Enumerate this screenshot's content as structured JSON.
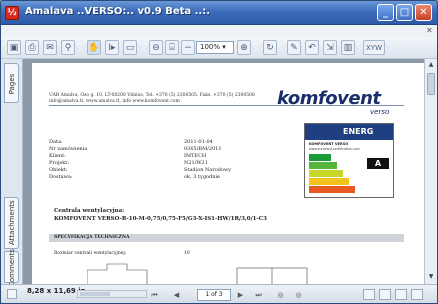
{
  "window": {
    "title": "Amalava ..VERSO:.. v0.9 Beta ..:.",
    "app_icon_glyph": "½"
  },
  "toolbar": {
    "zoom_value": "100%",
    "buttons": [
      "save-icon",
      "print-icon",
      "email-icon",
      "search-icon",
      "hand-tool-icon",
      "select-text-icon",
      "snapshot-icon",
      "zoom-out-icon",
      "zoom-in-icon",
      "fit-page-icon",
      "fit-width-icon",
      "rotate-icon",
      "comment-icon",
      "sign-icon",
      "highlight-icon",
      "stamp-icon"
    ]
  },
  "side_tabs": {
    "pages": "Pages",
    "attachments": "Attachments",
    "comments": "Comments"
  },
  "document": {
    "company_line1": "UAB Amalva, Ozo g. 10, LT-08200 Vilnius, Tel. +370 (5) 2300505, Faks. +370 (5) 2300508",
    "company_line2": "info@amalva.lt, www.amalva.lt, info www.komfovent.com",
    "logo": "komfovent",
    "logo_sub": "verso",
    "fields": [
      {
        "label": "Data:",
        "value": "2011-01-04"
      },
      {
        "label": "Nr zamówienia",
        "value": "0365/BM/2011"
      },
      {
        "label": "Klient:",
        "value": "IMTECH"
      },
      {
        "label": "Projekt:",
        "value": "N21/W21"
      },
      {
        "label": "Obiekt:",
        "value": "Stadion Narodowy"
      },
      {
        "label": "Dostawa:",
        "value": "ok. 3 tygodnie"
      }
    ],
    "unit_heading": "Centrala wentylacyjna:",
    "unit_name": "KOMFOVENT VERSO-R-10-M-0,75/0,75-F5/G3-X-IS1-HW/1R/3,0/1-C3",
    "spec_heading": "SPECYFIKACJA TECHNICZNA",
    "spec_row_label": "Rozmiar centrali wentylacyjnej:",
    "spec_row_value": "10",
    "energy_label": {
      "title": "ENERG",
      "brand": "KOMFOVENT VERSO",
      "url": "www.eurovent-certification.com",
      "class": "A"
    }
  },
  "status": {
    "page_size": "8,28 x 11,69 in",
    "page_indicator": "1 of 3"
  },
  "colors": {
    "title_bar": "#3d6cbc",
    "logo": "#1a2f6a",
    "energy_class_bg": "#1f3f82"
  }
}
